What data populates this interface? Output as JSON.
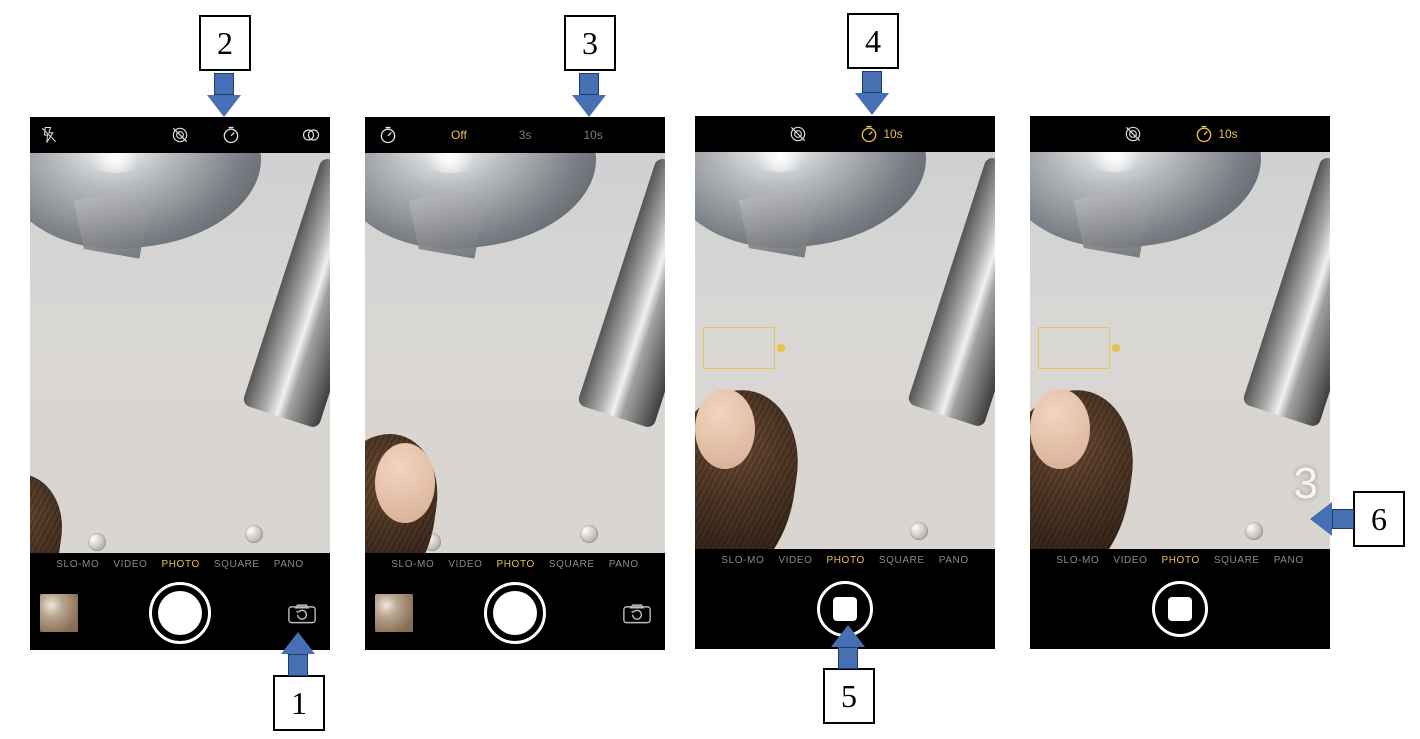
{
  "modes": [
    "SLO-MO",
    "VIDEO",
    "PHOTO",
    "SQUARE",
    "PANO"
  ],
  "selected_mode": "PHOTO",
  "timer_options_bar": {
    "off": "Off",
    "opt1": "3s",
    "opt2": "10s"
  },
  "timer_label_10s": "10s",
  "countdown_value": "3",
  "callouts": {
    "c1": "1",
    "c2": "2",
    "c3": "3",
    "c4": "4",
    "c5": "5",
    "c6": "6"
  }
}
